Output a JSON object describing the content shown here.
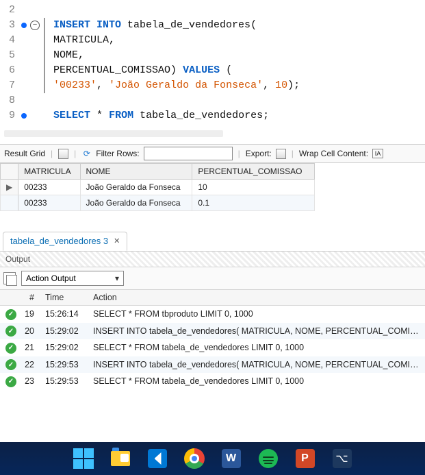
{
  "editor": {
    "lines": [
      {
        "n": "2",
        "dot": false,
        "fold": false,
        "bar": false,
        "html": ""
      },
      {
        "n": "3",
        "dot": true,
        "fold": true,
        "bar": true,
        "html": "<span class='kw-blue'>INSERT INTO</span> tabela_de_vendedores<span class='punct'>(</span>"
      },
      {
        "n": "4",
        "dot": false,
        "fold": false,
        "bar": true,
        "html": "MATRICULA<span class='punct'>,</span>"
      },
      {
        "n": "5",
        "dot": false,
        "fold": false,
        "bar": true,
        "html": "NOME<span class='punct'>,</span>"
      },
      {
        "n": "6",
        "dot": false,
        "fold": false,
        "bar": true,
        "html": "PERCENTUAL_COMISSAO<span class='punct'>)</span> <span class='kw-blue'>VALUES</span> <span class='punct'>(</span>"
      },
      {
        "n": "7",
        "dot": false,
        "fold": false,
        "bar": true,
        "html": "<span class='kw-orange'>'00233'</span><span class='punct'>,</span> <span class='kw-orange'>'João Geraldo da Fonseca'</span><span class='punct'>,</span> <span class='num'>10</span><span class='punct'>);</span>"
      },
      {
        "n": "8",
        "dot": false,
        "fold": false,
        "bar": false,
        "html": ""
      },
      {
        "n": "9",
        "dot": true,
        "fold": false,
        "bar": false,
        "html": "<span class='kw-blue'>SELECT</span> <span class='punct'>*</span> <span class='kw-blue'>FROM</span> tabela_de_vendedores<span class='punct'>;</span>"
      }
    ]
  },
  "result_header": {
    "label": "Result Grid",
    "filter_label": "Filter Rows:",
    "export_label": "Export:",
    "wrap_label": "Wrap Cell Content:"
  },
  "grid": {
    "columns": [
      "MATRICULA",
      "NOME",
      "PERCENTUAL_COMISSAO"
    ],
    "rows": [
      {
        "nav": "▶",
        "cells": [
          "00233",
          "João Geraldo da Fonseca",
          "10"
        ]
      },
      {
        "nav": "",
        "cells": [
          "00233",
          "João Geraldo da Fonseca",
          "0.1"
        ]
      }
    ]
  },
  "tab": {
    "label": "tabela_de_vendedores 3"
  },
  "output": {
    "title": "Output",
    "dropdown": "Action Output",
    "columns": [
      "#",
      "Time",
      "Action"
    ],
    "rows": [
      {
        "n": "19",
        "time": "15:26:14",
        "action": "SELECT * FROM tbproduto LIMIT 0, 1000",
        "alt": false
      },
      {
        "n": "20",
        "time": "15:29:02",
        "action": "INSERT INTO tabela_de_vendedores( MATRICULA, NOME, PERCENTUAL_COMISS...",
        "alt": true
      },
      {
        "n": "21",
        "time": "15:29:02",
        "action": "SELECT * FROM tabela_de_vendedores LIMIT 0, 1000",
        "alt": false
      },
      {
        "n": "22",
        "time": "15:29:53",
        "action": "INSERT INTO tabela_de_vendedores( MATRICULA, NOME, PERCENTUAL_COMISS...",
        "alt": true
      },
      {
        "n": "23",
        "time": "15:29:53",
        "action": "SELECT * FROM tabela_de_vendedores LIMIT 0, 1000",
        "alt": false
      }
    ]
  },
  "taskbar": {
    "word_letter": "W",
    "ppt_letter": "P",
    "other_glyph": "⌥"
  }
}
